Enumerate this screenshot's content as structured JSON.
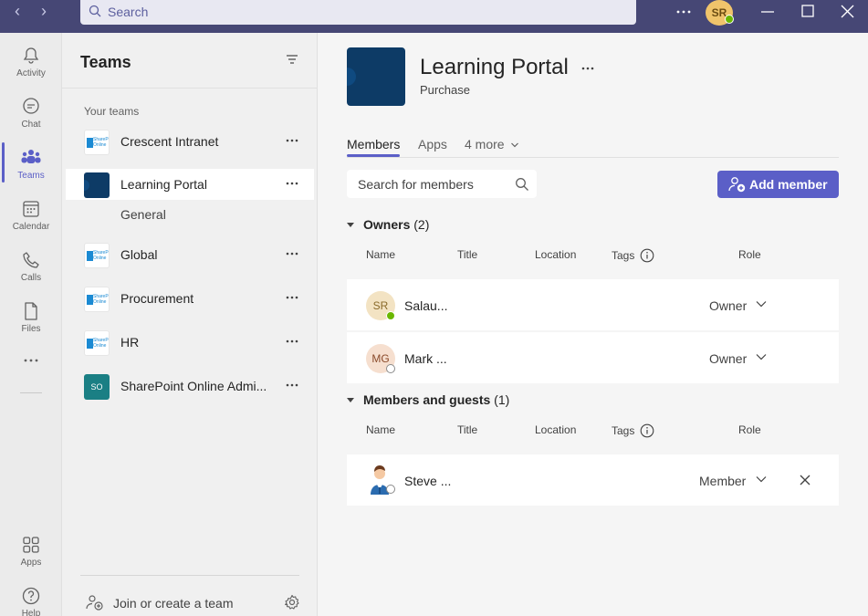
{
  "titlebar": {
    "search_placeholder": "Search",
    "avatar_initials": "SR"
  },
  "rail": {
    "items": [
      {
        "label": "Activity",
        "icon": "bell-icon"
      },
      {
        "label": "Chat",
        "icon": "chat-icon"
      },
      {
        "label": "Teams",
        "icon": "teams-icon",
        "active": true
      },
      {
        "label": "Calendar",
        "icon": "calendar-icon"
      },
      {
        "label": "Calls",
        "icon": "phone-icon"
      },
      {
        "label": "Files",
        "icon": "file-icon"
      },
      {
        "label": "Apps",
        "icon": "apps-icon"
      },
      {
        "label": "Help",
        "icon": "help-icon"
      }
    ]
  },
  "teams_pane": {
    "title": "Teams",
    "section_label": "Your teams",
    "teams": [
      {
        "name": "Crescent Intranet",
        "logo": "sharepoint",
        "logo_text": "SharePoint Online"
      },
      {
        "name": "Learning Portal",
        "logo": "navy",
        "selected": true
      },
      {
        "name": "Global",
        "logo": "sharepoint",
        "logo_text": "SharePoint Online"
      },
      {
        "name": "Procurement",
        "logo": "sharepoint",
        "logo_text": "SharePoint Online"
      },
      {
        "name": "HR",
        "logo": "sharepoint",
        "logo_text": "SharePoint Online"
      },
      {
        "name": "SharePoint Online Admi...",
        "logo": "initials",
        "logo_text": "SO"
      }
    ],
    "channel": "General",
    "join_label": "Join or create a team"
  },
  "main": {
    "team_title": "Learning Portal",
    "team_subtitle": "Purchase",
    "tabs": [
      {
        "label": "Members",
        "active": true
      },
      {
        "label": "Apps"
      },
      {
        "label": "4 more"
      }
    ],
    "search_placeholder": "Search for members",
    "add_member_label": "Add member",
    "columns": {
      "name": "Name",
      "title": "Title",
      "location": "Location",
      "tags": "Tags",
      "role": "Role"
    },
    "owners": {
      "label": "Owners",
      "count": "(2)",
      "members": [
        {
          "initials": "SR",
          "name": "Salau...",
          "role": "Owner",
          "presence": "available"
        },
        {
          "initials": "MG",
          "name": "Mark ...",
          "role": "Owner",
          "presence": "offline"
        }
      ]
    },
    "guests": {
      "label": "Members and guests",
      "count": "(1)",
      "members": [
        {
          "name": "Steve ...",
          "role": "Member",
          "presence": "offline"
        }
      ]
    }
  },
  "colors": {
    "titlebar": "#464775",
    "accent": "#5b5fc7",
    "team_navy": "#0d3b66",
    "so_teal": "#1a7f84"
  }
}
